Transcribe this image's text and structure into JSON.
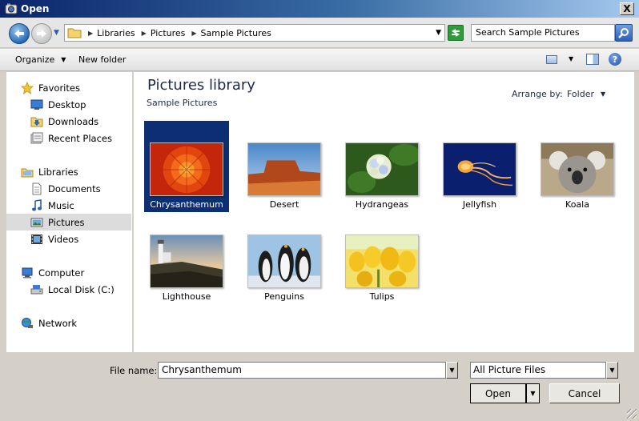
{
  "window": {
    "title": "Open",
    "close_label": "X"
  },
  "nav": {
    "breadcrumbs": [
      "Libraries",
      "Pictures",
      "Sample Pictures"
    ],
    "search_placeholder": "Search Sample Pictures"
  },
  "toolbar": {
    "organize_label": "Organize",
    "new_folder_label": "New folder",
    "help_label": "?"
  },
  "sidebar": {
    "items": [
      {
        "label": "Favorites",
        "icon": "star-icon",
        "level": 1
      },
      {
        "label": "Desktop",
        "icon": "desktop-icon",
        "level": 2
      },
      {
        "label": "Downloads",
        "icon": "downloads-icon",
        "level": 2
      },
      {
        "label": "Recent Places",
        "icon": "recent-places-icon",
        "level": 2
      },
      {
        "label": "Libraries",
        "icon": "libraries-icon",
        "level": 1
      },
      {
        "label": "Documents",
        "icon": "documents-icon",
        "level": 2
      },
      {
        "label": "Music",
        "icon": "music-icon",
        "level": 2
      },
      {
        "label": "Pictures",
        "icon": "pictures-icon",
        "level": 2,
        "selected": true
      },
      {
        "label": "Videos",
        "icon": "videos-icon",
        "level": 2
      },
      {
        "label": "Computer",
        "icon": "computer-icon",
        "level": 1
      },
      {
        "label": "Local Disk (C:)",
        "icon": "local-disk-icon",
        "level": 2
      },
      {
        "label": "Network",
        "icon": "network-icon",
        "level": 1
      }
    ]
  },
  "library": {
    "title": "Pictures library",
    "subtitle": "Sample Pictures",
    "arrange_label": "Arrange by:",
    "arrange_value": "Folder"
  },
  "files": [
    {
      "name": "Chrysanthemum",
      "selected": true
    },
    {
      "name": "Desert"
    },
    {
      "name": "Hydrangeas"
    },
    {
      "name": "Jellyfish"
    },
    {
      "name": "Koala"
    },
    {
      "name": "Lighthouse"
    },
    {
      "name": "Penguins"
    },
    {
      "name": "Tulips"
    }
  ],
  "bottom": {
    "file_name_label": "File name:",
    "file_name_value": "Chrysanthemum",
    "file_type_value": "All Picture Files",
    "open_label": "Open",
    "cancel_label": "Cancel"
  },
  "colors": {
    "selection": "#0c2f74",
    "accent": "#2a6bb4"
  }
}
